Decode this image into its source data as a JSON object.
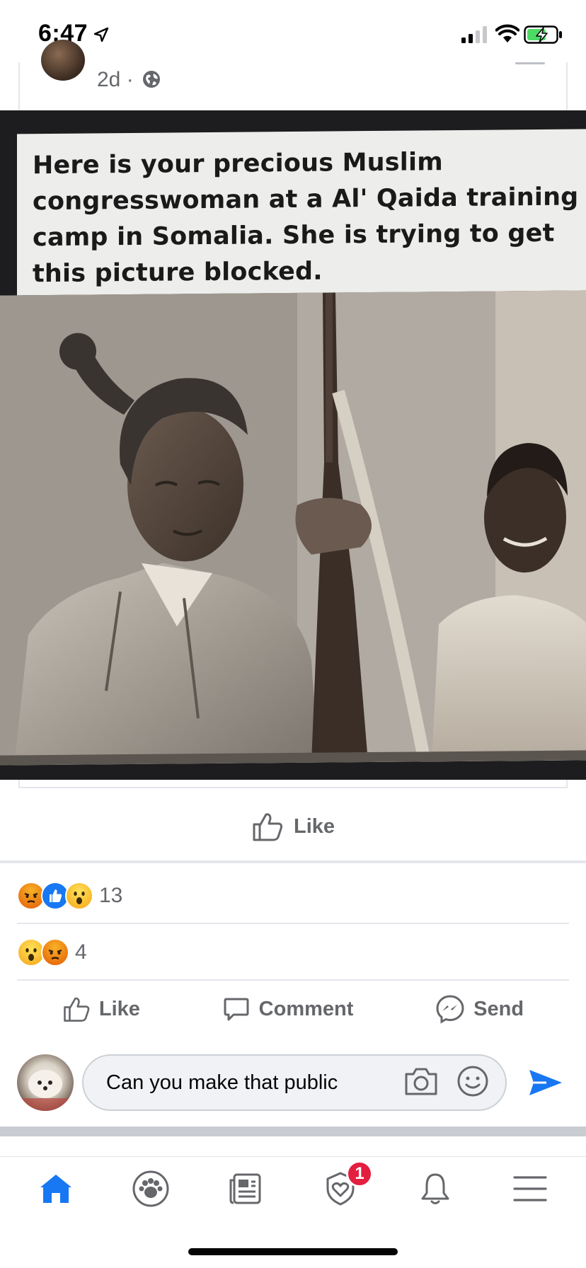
{
  "status_bar": {
    "time": "6:47",
    "icons": [
      "location-arrow-icon",
      "cellular-signal-icon",
      "wifi-icon",
      "battery-charging-icon"
    ]
  },
  "post": {
    "timestamp": "2d",
    "separator": "·",
    "privacy_icon": "globe-icon",
    "image": {
      "caption_lines": [
        "Here is your precious Muslim",
        "congresswoman at a Al' Qaida training",
        "camp in Somalia. She is trying to get",
        "this picture blocked."
      ]
    },
    "shared_like_label": "Like"
  },
  "reactions": {
    "post": {
      "icons": [
        "angry",
        "like",
        "wow"
      ],
      "count": "13"
    },
    "comment": {
      "icons": [
        "wow",
        "angry"
      ],
      "count": "4"
    }
  },
  "actions": {
    "like": "Like",
    "comment": "Comment",
    "send": "Send"
  },
  "composer": {
    "value": "Can you make that public"
  },
  "tab_bar": {
    "tabs": [
      "home",
      "groups",
      "news",
      "dating",
      "notifications",
      "menu"
    ],
    "active": "home",
    "dating_badge": "1"
  },
  "colors": {
    "accent": "#1877f2",
    "secondary_text": "#65676b",
    "divider": "#e4e6eb",
    "badge": "#e41e3f"
  }
}
